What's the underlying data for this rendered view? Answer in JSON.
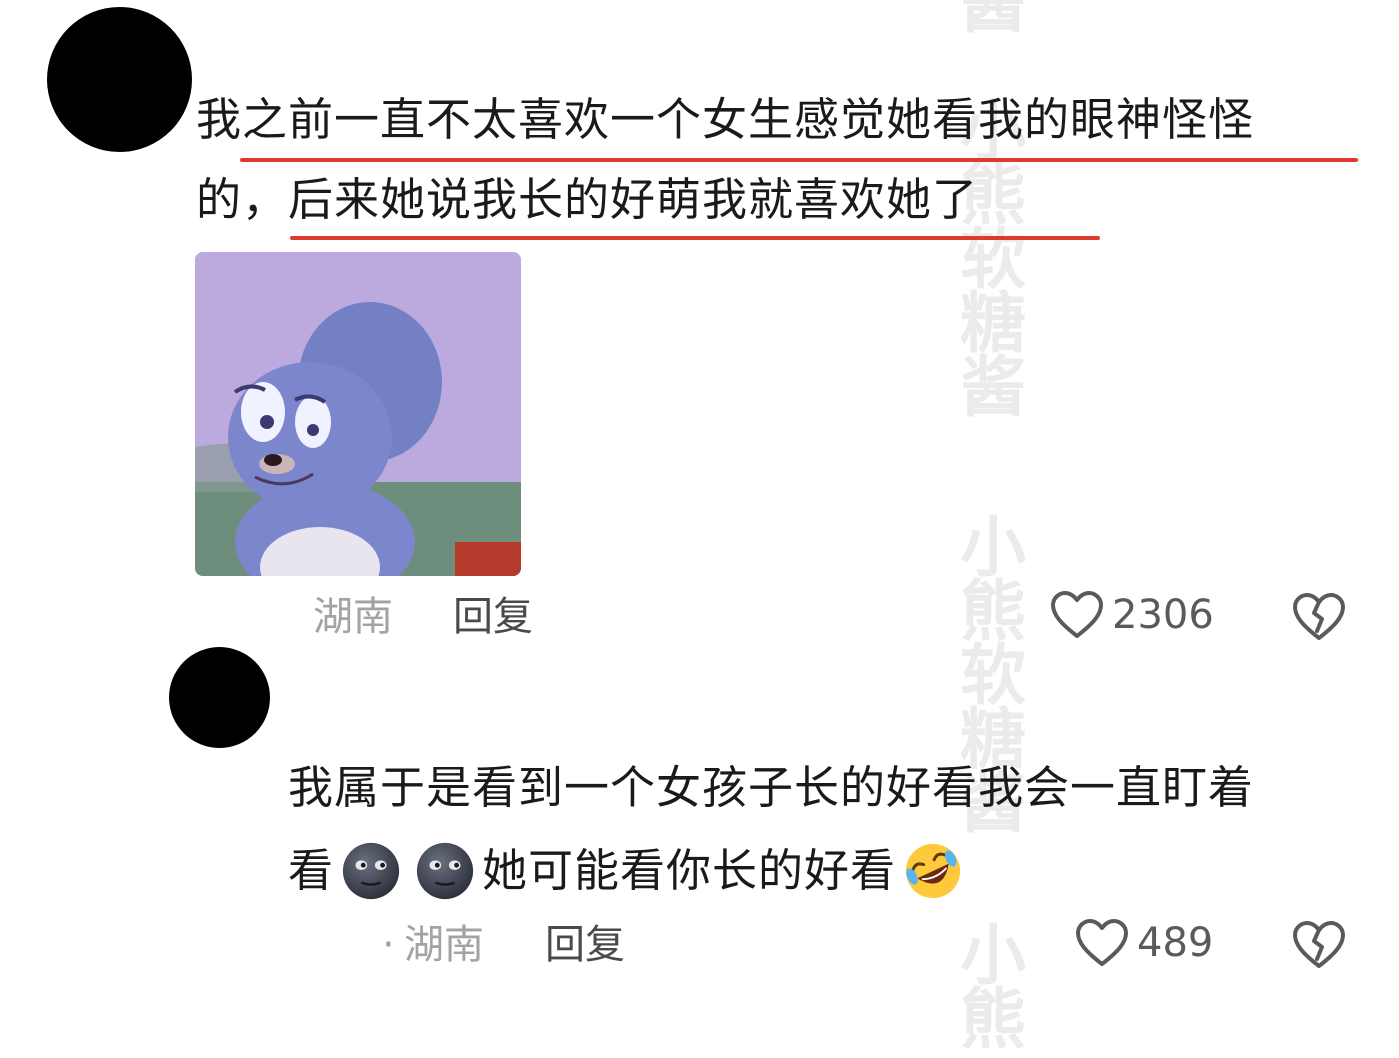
{
  "watermark": {
    "chars": [
      "小",
      "熊",
      "软",
      "糖",
      "酱"
    ]
  },
  "comments": [
    {
      "text_lines": [
        "我之前一直不太喜欢一个女生感觉她看我的眼神怪怪",
        "的，后来她说我长的好萌我就喜欢她了"
      ],
      "has_image": true,
      "location": "湖南",
      "reply_label": "回复",
      "like_count": "2306"
    },
    {
      "text_lines": [
        "我属于是看到一个女孩子长的好看我会一直盯着"
      ],
      "line2_prefix": "看",
      "line2_suffix": "她可能看你长的好看",
      "location": "湖南",
      "location_prefix": "·",
      "reply_label": "回复",
      "like_count": "489"
    }
  ],
  "colors": {
    "underline": "#e03a2f",
    "watermark": "#ebebeb",
    "location": "#a3a3a3"
  },
  "icons": {
    "like": "heart-outline-icon",
    "dislike": "broken-heart-icon",
    "emoji_1": "new-moon-face-emoji",
    "emoji_2": "rolling-on-floor-laughing-emoji"
  }
}
